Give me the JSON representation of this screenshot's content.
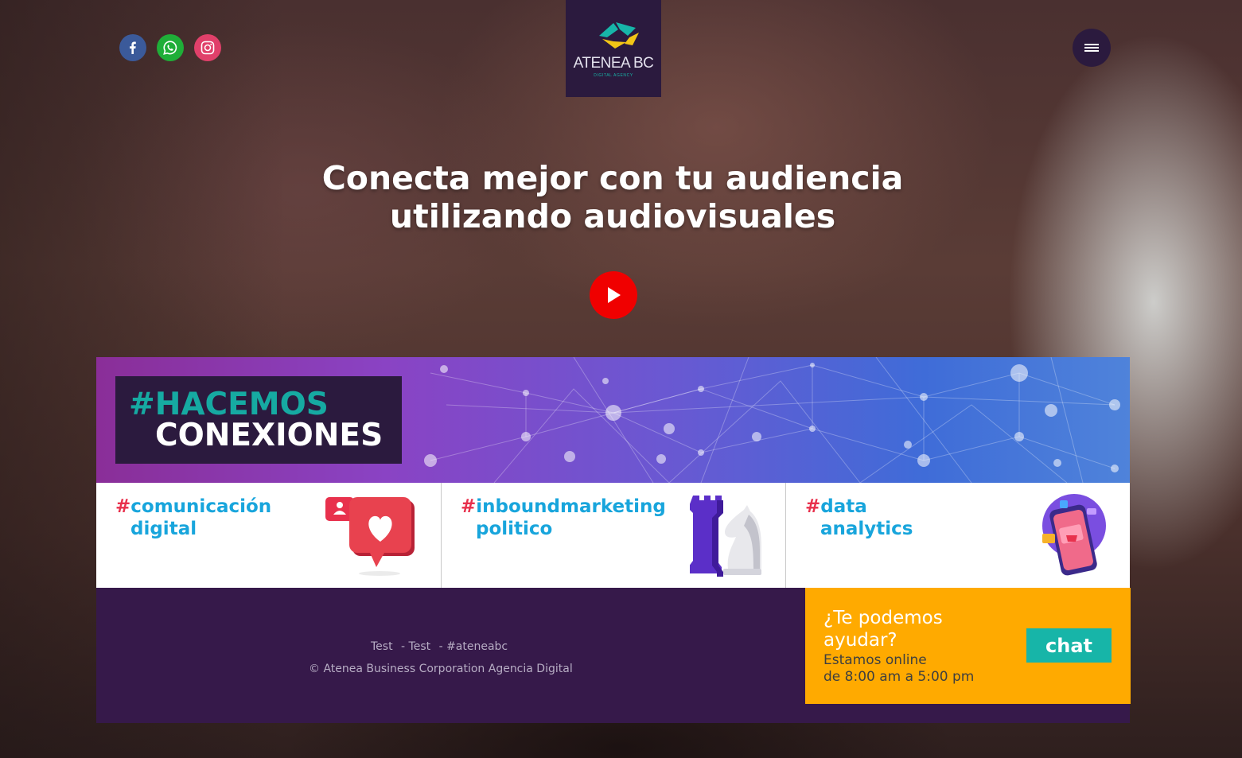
{
  "brand": {
    "logo_name": "ATENEA BC",
    "logo_tagline": "DIGITAL AGENCY",
    "colors": {
      "primary_dark": "#2b1a3e",
      "teal": "#17b5a8",
      "yellow": "#ffaa00",
      "red": "#e8314d",
      "blue": "#18a5dc"
    }
  },
  "social": [
    {
      "name": "facebook",
      "icon": "facebook-icon"
    },
    {
      "name": "whatsapp",
      "icon": "whatsapp-icon"
    },
    {
      "name": "instagram",
      "icon": "instagram-icon"
    }
  ],
  "menu": {
    "icon": "hamburger-menu-icon"
  },
  "hero": {
    "title_line1": "Conecta mejor con tu audiencia",
    "title_line2": "utilizando audiovisuales",
    "play_icon": "play-icon"
  },
  "banner": {
    "hash": "#",
    "word1": "HACEMOS",
    "word2": "CONEXIONES"
  },
  "cards": [
    {
      "hash": "#",
      "line1": "comunicación",
      "line2": "digital",
      "icon": "heart-speech-bubble-icon"
    },
    {
      "hash": "#",
      "line1": "inboundmarketing",
      "line2": "politico",
      "icon": "chess-pieces-icon"
    },
    {
      "hash": "#",
      "line1": "data",
      "line2": "analytics",
      "icon": "shopping-phone-icon"
    }
  ],
  "footer": {
    "links": [
      "Test",
      "- Test",
      "- #ateneabc"
    ],
    "copyright": "© Atenea Business Corporation Agencia Digital"
  },
  "help": {
    "question": "¿Te podemos ayudar?",
    "online_line1": "Estamos online",
    "online_line2": "de 8:00 am a 5:00 pm",
    "chat_label": "chat"
  }
}
